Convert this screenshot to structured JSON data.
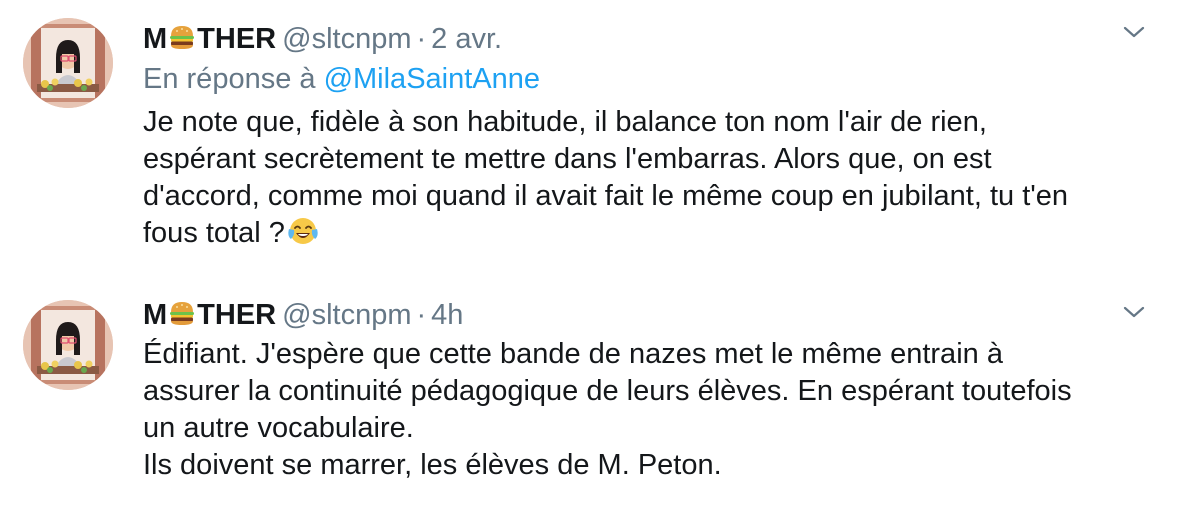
{
  "tweets": [
    {
      "name_pre": "M",
      "name_post": "THER",
      "handle": "@sltcnpm",
      "separator": "·",
      "time": "2 avr.",
      "reply_prefix": "En réponse à",
      "reply_to": "@MilaSaintAnne",
      "text_lines": [
        "Je note que, fidèle à son habitude, il balance ton nom l'air de rien,",
        "espérant secrètement te mettre dans l'embarras. Alors que, on est",
        "d'accord, comme moi quand il avait fait le même coup en jubilant, tu t'en",
        "fous total ?"
      ],
      "icons": {
        "name_emoji": "hamburger-emoji-icon",
        "text_emoji": "tears-of-joy-emoji-icon",
        "menu": "chevron-down-icon"
      }
    },
    {
      "name_pre": "M",
      "name_post": "THER",
      "handle": "@sltcnpm",
      "separator": "·",
      "time": "4h",
      "text_lines": [
        "Édifiant. J'espère que cette bande de nazes met le même entrain à",
        "assurer la continuité pédagogique de leurs élèves. En espérant toutefois",
        "un autre vocabulaire.",
        "Ils doivent se marrer, les élèves de M. Peton."
      ],
      "icons": {
        "name_emoji": "hamburger-emoji-icon",
        "menu": "chevron-down-icon"
      }
    }
  ],
  "colors": {
    "text": "#14171a",
    "muted": "#657786",
    "link": "#1da1f2"
  }
}
